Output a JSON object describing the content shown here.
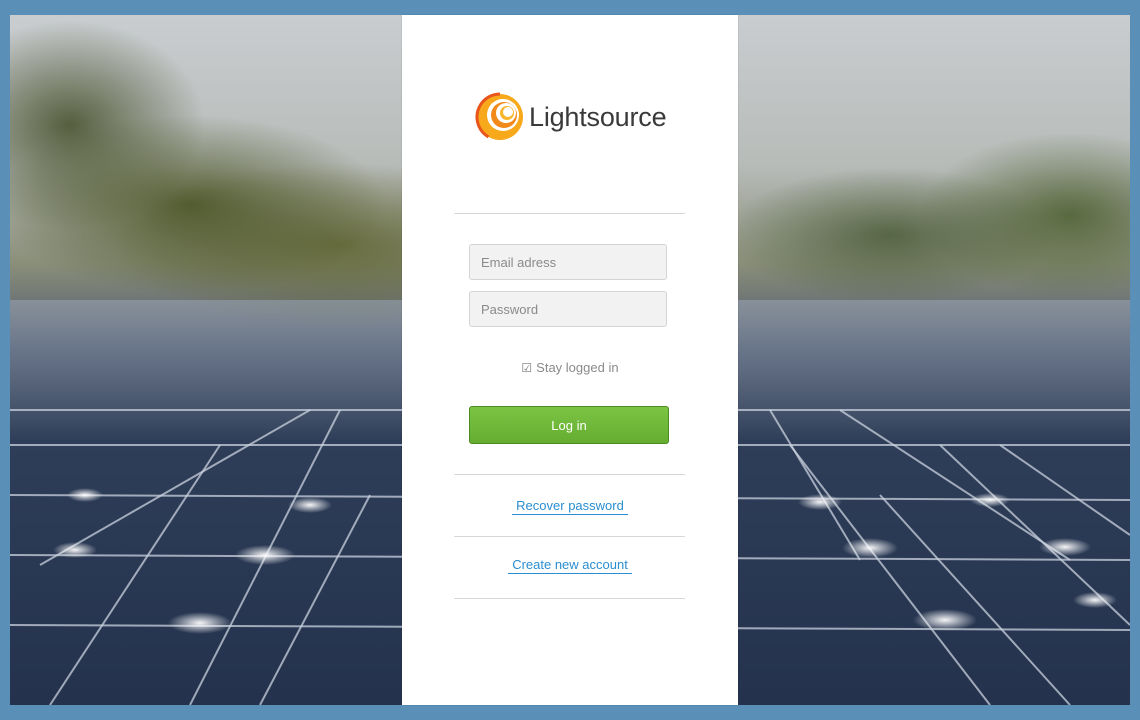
{
  "brand": {
    "name": "Lightsource",
    "logo_colors": [
      "#f7a81b",
      "#ef7d1a",
      "#e9541b"
    ]
  },
  "form": {
    "email_placeholder": "Email adress",
    "password_placeholder": "Password",
    "stay_logged_in_label": "Stay logged in",
    "stay_logged_in_checked": true,
    "login_label": "Log in"
  },
  "links": {
    "recover_password": "Recover password",
    "create_account": "Create new account"
  },
  "colors": {
    "accent_green": "#6ab535",
    "link_blue": "#2a8ed0",
    "frame_blue": "#5a90b8"
  }
}
